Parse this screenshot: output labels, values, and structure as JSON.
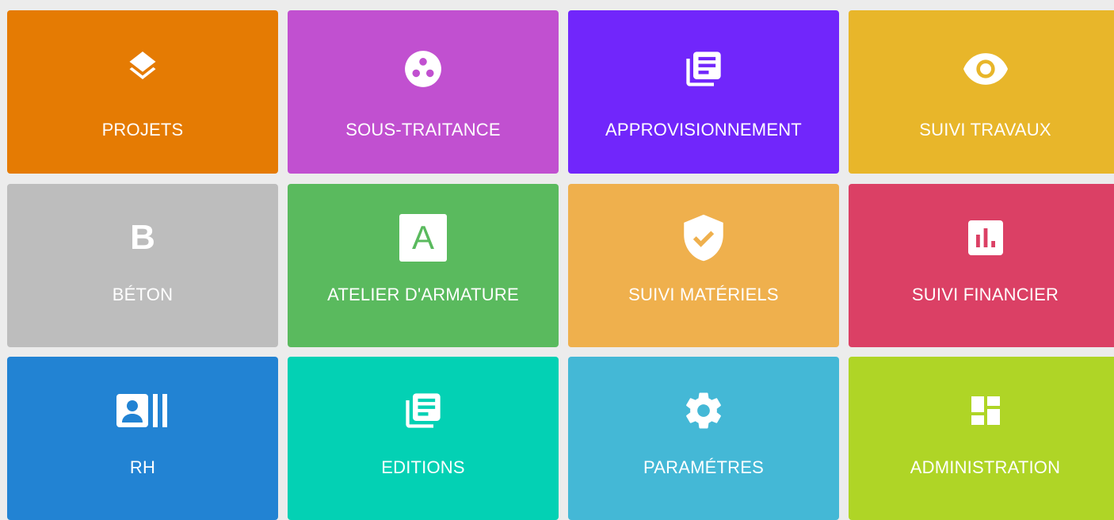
{
  "tiles": [
    {
      "label": "PROJETS",
      "icon": "layers-icon",
      "color": "#e57b03"
    },
    {
      "label": "SOUS-TRAITANCE",
      "icon": "three-dots-circle-icon",
      "color": "#c150d0"
    },
    {
      "label": "APPROVISIONNEMENT",
      "icon": "library-books-icon",
      "color": "#7126fb"
    },
    {
      "label": "SUIVI TRAVAUX",
      "icon": "eye-icon",
      "color": "#e8b62a"
    },
    {
      "label": "BÉTON",
      "icon": "letter-b-icon",
      "color": "#bdbdbd"
    },
    {
      "label": "ATELIER D'ARMATURE",
      "icon": "letter-a-box-icon",
      "color": "#5aba5e"
    },
    {
      "label": "SUIVI MATÉRIELS",
      "icon": "shield-check-icon",
      "color": "#efb04d"
    },
    {
      "label": "SUIVI FINANCIER",
      "icon": "bar-chart-box-icon",
      "color": "#db4065"
    },
    {
      "label": "RH",
      "icon": "contact-card-icon",
      "color": "#2283d3"
    },
    {
      "label": "EDITIONS",
      "icon": "library-books-icon",
      "color": "#03d1b4"
    },
    {
      "label": "PARAMÉTRES",
      "icon": "gear-icon",
      "color": "#44b8d6"
    },
    {
      "label": "ADMINISTRATION",
      "icon": "dashboard-icon",
      "color": "#afd526"
    }
  ],
  "letters": {
    "b": "B",
    "a": "A"
  }
}
